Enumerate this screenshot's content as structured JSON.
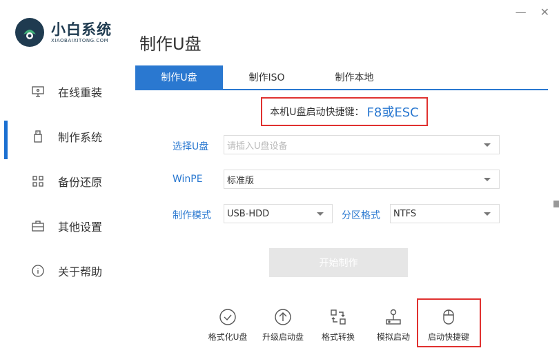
{
  "app": {
    "title": "小白系统",
    "subtitle": "XIAOBAIXITONG.COM"
  },
  "window_controls": {
    "minimize": "—",
    "close": "✕"
  },
  "page_title": "制作U盘",
  "sidebar": {
    "items": [
      {
        "label": "在线重装",
        "icon": "monitor-icon",
        "active": false
      },
      {
        "label": "制作系统",
        "icon": "usb-icon",
        "active": true
      },
      {
        "label": "备份还原",
        "icon": "grid-icon",
        "active": false
      },
      {
        "label": "其他设置",
        "icon": "briefcase-icon",
        "active": false
      },
      {
        "label": "关于帮助",
        "icon": "info-icon",
        "active": false
      }
    ]
  },
  "tabs": [
    {
      "label": "制作U盘",
      "active": true
    },
    {
      "label": "制作ISO",
      "active": false
    },
    {
      "label": "制作本地",
      "active": false
    }
  ],
  "hotkey": {
    "prefix": "本机U盘启动快捷键：",
    "value": "F8或ESC"
  },
  "form": {
    "usb_label": "选择U盘",
    "usb_placeholder": "请插入U盘设备",
    "winpe_label": "WinPE",
    "winpe_value": "标准版",
    "mode_label": "制作模式",
    "mode_value": "USB-HDD",
    "partition_label": "分区格式",
    "partition_value": "NTFS"
  },
  "start_button": "开始制作",
  "tools": [
    {
      "label": "格式化U盘",
      "icon": "check-circle-icon"
    },
    {
      "label": "升级启动盘",
      "icon": "upgrade-circle-icon"
    },
    {
      "label": "格式转换",
      "icon": "convert-icon"
    },
    {
      "label": "模拟启动",
      "icon": "joystick-icon"
    },
    {
      "label": "启动快捷键",
      "icon": "mouse-icon"
    }
  ],
  "colors": {
    "accent": "#2a78d0",
    "highlight": "#e0312f",
    "logo": "#1f3b50"
  }
}
